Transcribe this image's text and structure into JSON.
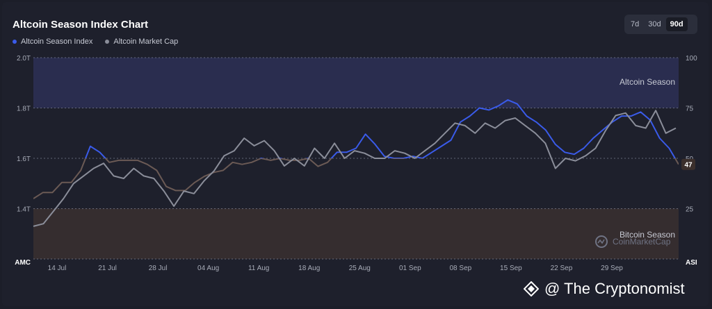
{
  "header": {
    "title": "Altcoin Season Index Chart",
    "range_buttons": [
      {
        "label": "7d",
        "active": false
      },
      {
        "label": "30d",
        "active": false
      },
      {
        "label": "90d",
        "active": true
      }
    ]
  },
  "legend": [
    {
      "label": "Altcoin Season Index",
      "color": "#3a5bea"
    },
    {
      "label": "Altcoin Market Cap",
      "color": "#8b8e9a"
    }
  ],
  "zones": {
    "altcoin_label": "Altcoin Season",
    "bitcoin_label": "Bitcoin Season",
    "altcoin_color": "#2a2d4f",
    "bitcoin_color": "#352d2f"
  },
  "watermark": {
    "text": "@ The Cryptonomist",
    "brand": "CoinMarketCap"
  },
  "chart_data": {
    "type": "line",
    "left_axis": {
      "label": "AMC",
      "ticks": [
        "2.0T",
        "1.8T",
        "1.6T",
        "1.4T"
      ],
      "range": [
        1.2,
        2.0
      ],
      "unit": "T"
    },
    "right_axis": {
      "label": "ASI",
      "ticks": [
        "100",
        "75",
        "50",
        "25"
      ],
      "range": [
        0,
        100
      ]
    },
    "x_ticks": [
      "14 Jul",
      "21 Jul",
      "28 Jul",
      "04 Aug",
      "11 Aug",
      "18 Aug",
      "25 Aug",
      "01 Sep",
      "08 Sep",
      "15 Sep",
      "22 Sep",
      "29 Sep"
    ],
    "current_index_label": "47",
    "series": [
      {
        "name": "Altcoin Season Index",
        "axis": "right",
        "color_above": "#3a5bea",
        "color_below": "#6b5a55",
        "values": [
          30,
          33,
          33,
          38,
          38,
          44,
          56,
          53,
          48,
          49,
          49,
          49,
          47,
          44,
          36,
          34,
          34,
          38,
          41,
          43,
          44,
          48,
          47,
          48,
          50,
          49,
          50,
          49,
          49,
          50,
          46,
          48,
          53,
          53,
          55,
          62,
          57,
          51,
          50,
          50,
          51,
          50,
          53,
          56,
          59,
          68,
          71,
          75,
          74,
          76,
          79,
          77,
          71,
          68,
          64,
          57,
          53,
          52,
          55,
          60,
          64,
          68,
          71,
          71,
          73,
          69,
          60,
          55,
          47
        ]
      },
      {
        "name": "Altcoin Market Cap",
        "axis": "left",
        "color": "#8b8e9a",
        "values": [
          1.33,
          1.34,
          1.39,
          1.44,
          1.5,
          1.53,
          1.56,
          1.58,
          1.53,
          1.52,
          1.56,
          1.53,
          1.52,
          1.47,
          1.41,
          1.47,
          1.46,
          1.51,
          1.55,
          1.61,
          1.63,
          1.68,
          1.65,
          1.67,
          1.63,
          1.57,
          1.6,
          1.57,
          1.64,
          1.6,
          1.66,
          1.6,
          1.63,
          1.62,
          1.6,
          1.6,
          1.63,
          1.62,
          1.6,
          1.63,
          1.66,
          1.7,
          1.74,
          1.73,
          1.7,
          1.74,
          1.72,
          1.75,
          1.76,
          1.73,
          1.7,
          1.66,
          1.56,
          1.6,
          1.59,
          1.61,
          1.64,
          1.71,
          1.77,
          1.78,
          1.73,
          1.72,
          1.79,
          1.7,
          1.72
        ]
      }
    ]
  }
}
